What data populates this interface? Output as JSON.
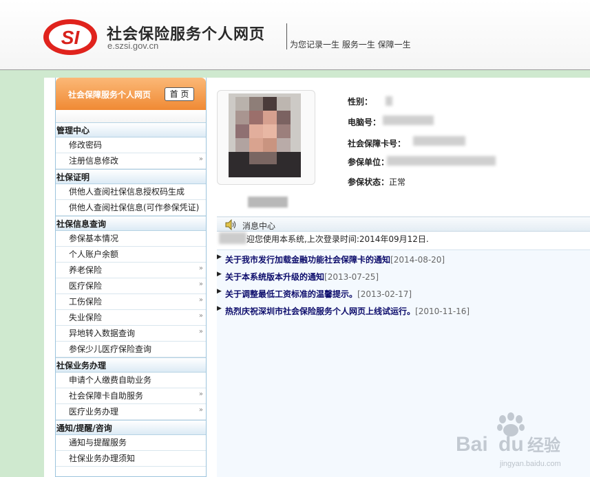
{
  "header": {
    "logo_text": "SI",
    "site_title": "社会保险服务个人网页",
    "site_domain": "e.szsi.gov.cn",
    "slogan": "为您记录一生 服务一生 保障一生"
  },
  "sidebar": {
    "title": "社会保障服务个人网页",
    "home_button": "首 页",
    "sections": [
      {
        "title": "管理中心",
        "items": [
          {
            "label": "修改密码",
            "has_submenu": false
          },
          {
            "label": "注册信息修改",
            "has_submenu": true
          }
        ]
      },
      {
        "title": "社保证明",
        "items": [
          {
            "label": "供他人查阅社保信息授权码生成",
            "has_submenu": false
          },
          {
            "label": "供他人查阅社保信息(可作参保凭证)",
            "has_submenu": false
          }
        ]
      },
      {
        "title": "社保信息查询",
        "items": [
          {
            "label": "参保基本情况",
            "has_submenu": false
          },
          {
            "label": "个人账户余额",
            "has_submenu": false
          },
          {
            "label": "养老保险",
            "has_submenu": true
          },
          {
            "label": "医疗保险",
            "has_submenu": true
          },
          {
            "label": "工伤保险",
            "has_submenu": true
          },
          {
            "label": "失业保险",
            "has_submenu": true
          },
          {
            "label": "异地转入数据查询",
            "has_submenu": true
          },
          {
            "label": "参保少儿医疗保险查询",
            "has_submenu": false
          }
        ]
      },
      {
        "title": "社保业务办理",
        "items": [
          {
            "label": "申请个人缴费自助业务",
            "has_submenu": false
          },
          {
            "label": "社会保障卡自助服务",
            "has_submenu": true
          },
          {
            "label": "医疗业务办理",
            "has_submenu": true
          }
        ]
      },
      {
        "title": "通知/提醒/咨询",
        "items": [
          {
            "label": "通知与提醒服务",
            "has_submenu": false
          },
          {
            "label": "社保业务办理须知",
            "has_submenu": false
          }
        ]
      }
    ]
  },
  "profile": {
    "gender_label": "性别：",
    "computer_no_label": "电脑号：",
    "card_no_label": "社会保障卡号：",
    "employer_label": "参保单位：",
    "status_label": "参保状态：",
    "status_value": "正常"
  },
  "messages": {
    "title": "消息中心",
    "welcome": "迎您使用本系统,上次登录时间:2014年09月12日.",
    "news": [
      {
        "title": "关于我市发行加载金融功能社会保障卡的通知",
        "date": "[2014-08-20]"
      },
      {
        "title": "关于本系统版本升级的通知",
        "date": "[2013-07-25]"
      },
      {
        "title": "关于调整最低工资标准的温馨提示。",
        "date": "[2013-02-17]"
      },
      {
        "title": "热烈庆祝深圳市社会保险服务个人网页上线试运行。",
        "date": "[2010-11-16]"
      }
    ]
  },
  "watermark": {
    "brand": "Bai",
    "brand2": "经验",
    "url": "jingyan.baidu.com"
  },
  "colors": {
    "accent_orange": "#f08a34",
    "news_title": "#0c0c6b",
    "logo_red": "#d8221c",
    "page_bg": "#cfe9cf"
  }
}
